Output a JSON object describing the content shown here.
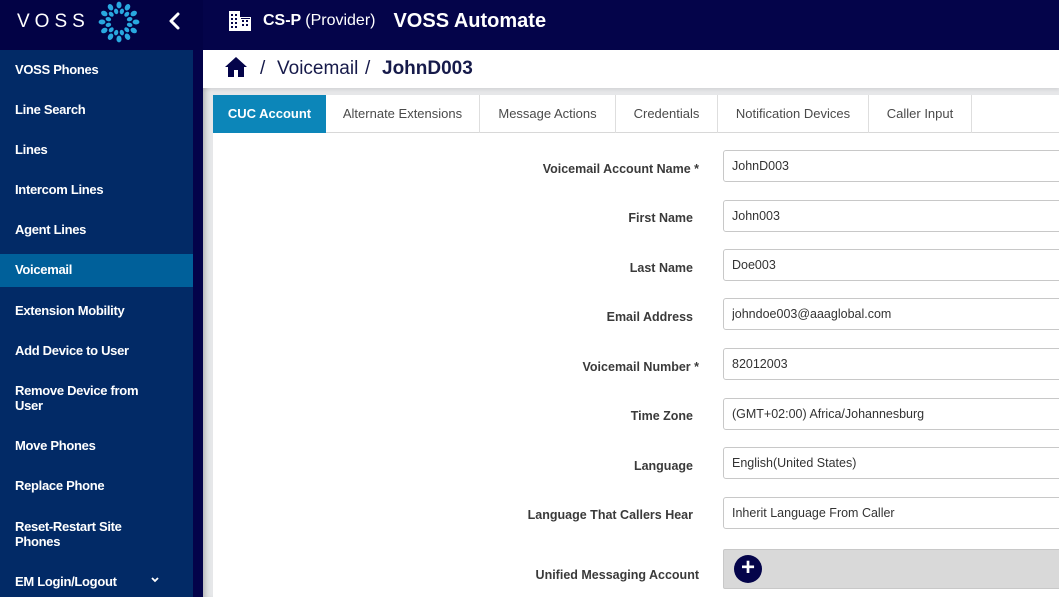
{
  "header": {
    "brand": "VOSS",
    "collapse_icon": "chevron-left-icon",
    "provider_icon": "building-icon",
    "provider_name": "CS-P",
    "provider_role": "(Provider)",
    "app_title": "VOSS Automate"
  },
  "sidebar": {
    "items": [
      {
        "label": "VOSS Phones"
      },
      {
        "label": "Line Search"
      },
      {
        "label": "Lines"
      },
      {
        "label": "Intercom Lines"
      },
      {
        "label": "Agent Lines"
      },
      {
        "label": "Voicemail",
        "active": true
      },
      {
        "label": "Extension Mobility"
      },
      {
        "label": "Add Device to User"
      },
      {
        "label": "Remove Device from User"
      },
      {
        "label": "Move Phones"
      },
      {
        "label": "Replace Phone"
      },
      {
        "label": "Reset-Restart Site Phones"
      },
      {
        "label": "EM Login/Logout",
        "expandable": true
      }
    ]
  },
  "breadcrumb": {
    "home_icon": "home-icon",
    "separator": "/",
    "items": [
      "Voicemail",
      "JohnD003"
    ]
  },
  "tabs": [
    {
      "label": "CUC Account",
      "active": true
    },
    {
      "label": "Alternate Extensions"
    },
    {
      "label": "Message Actions"
    },
    {
      "label": "Credentials"
    },
    {
      "label": "Notification Devices"
    },
    {
      "label": "Caller Input"
    }
  ],
  "form": {
    "fields": [
      {
        "label": "Voicemail Account Name *",
        "value": "JohnD003"
      },
      {
        "label": "First Name",
        "value": "John003"
      },
      {
        "label": "Last Name",
        "value": "Doe003"
      },
      {
        "label": "Email Address",
        "value": "johndoe003@aaaglobal.com"
      },
      {
        "label": "Voicemail Number *",
        "value": "82012003"
      },
      {
        "label": "Time Zone",
        "value": "(GMT+02:00) Africa/Johannesburg"
      },
      {
        "label": "Language",
        "value": "English(United States)"
      },
      {
        "label": "Language That Callers Hear",
        "value": "Inherit Language From Caller"
      }
    ],
    "unified_messaging": {
      "label": "Unified Messaging Account",
      "add_icon": "plus-icon",
      "add_symbol": "+"
    }
  },
  "colors": {
    "topbar": "#04044a",
    "sidebar": "#022a66",
    "sidebar_active": "#00609a",
    "tab_active": "#0c86b9",
    "logo": "#29a8e0"
  }
}
